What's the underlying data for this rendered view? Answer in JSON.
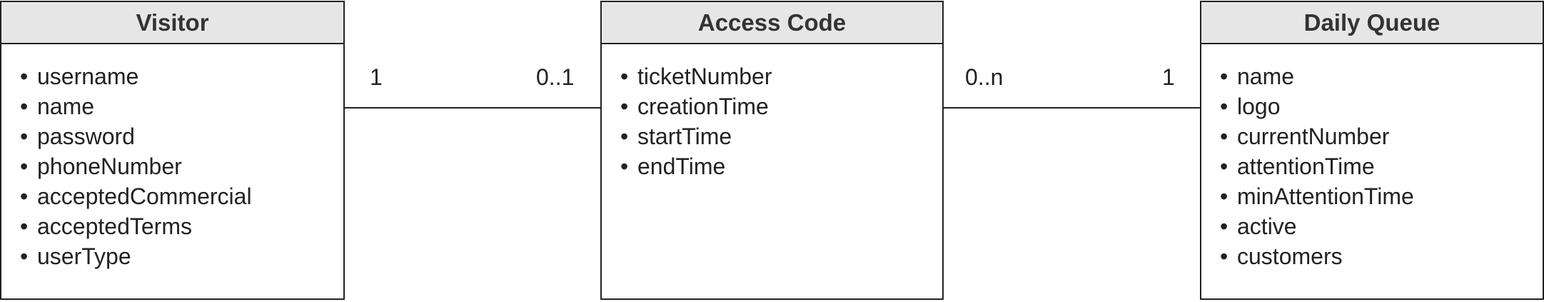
{
  "entities": {
    "visitor": {
      "title": "Visitor",
      "attributes": [
        "username",
        "name",
        "password",
        "phoneNumber",
        "acceptedCommercial",
        "acceptedTerms",
        "userType"
      ]
    },
    "access_code": {
      "title": "Access Code",
      "attributes": [
        "ticketNumber",
        "creationTime",
        "startTime",
        "endTime"
      ]
    },
    "daily_queue": {
      "title": "Daily Queue",
      "attributes": [
        "name",
        "logo",
        "currentNumber",
        "attentionTime",
        "minAttentionTime",
        "active",
        "customers"
      ]
    }
  },
  "relations": {
    "visitor_access": {
      "from_multiplicity": "1",
      "to_multiplicity": "0..1"
    },
    "access_queue": {
      "from_multiplicity": "0..n",
      "to_multiplicity": "1"
    }
  },
  "bullet_char": "•",
  "colors": {
    "header_fill": "#e6e6e6",
    "border": "#222222"
  }
}
